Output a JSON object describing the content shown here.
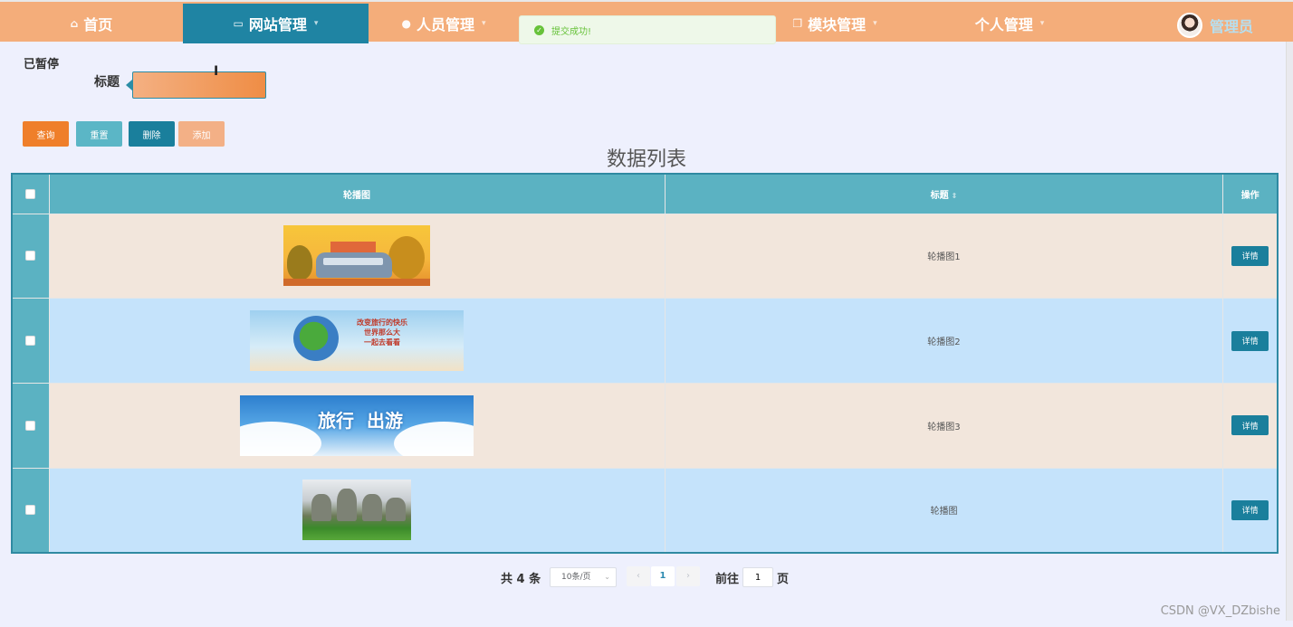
{
  "nav": {
    "items": [
      {
        "label": "首页",
        "icon": "home-icon",
        "active": false,
        "dropdown": false
      },
      {
        "label": "网站管理",
        "icon": "monitor-icon",
        "active": true,
        "dropdown": true
      },
      {
        "label": "人员管理",
        "icon": "user-icon",
        "active": false,
        "dropdown": true
      },
      {
        "label": "模块管理",
        "icon": "module-icon",
        "active": false,
        "dropdown": true
      },
      {
        "label": "个人管理",
        "icon": "",
        "active": false,
        "dropdown": true
      }
    ],
    "admin_label": "管理员"
  },
  "toast": {
    "message": "提交成功!",
    "type": "success"
  },
  "status_text": "已暂停",
  "search": {
    "label": "标题",
    "value": ""
  },
  "buttons": {
    "query": "查询",
    "reset": "重置",
    "delete": "删除",
    "add": "添加"
  },
  "list_title": "数据列表",
  "table": {
    "headers": {
      "image": "轮播图",
      "title": "标题",
      "actions": "操作"
    },
    "rows": [
      {
        "title": "轮播图1",
        "action": "详情",
        "image": "autumn-bus-illustration"
      },
      {
        "title": "轮播图2",
        "action": "详情",
        "image": "travel-globe-banner",
        "image_text": [
          "改变旅行的快乐",
          "世界那么大",
          "一起去看看"
        ]
      },
      {
        "title": "轮播图3",
        "action": "详情",
        "image": "travel-clouds-banner",
        "image_text": [
          "旅行",
          "出游"
        ]
      },
      {
        "title": "轮播图",
        "action": "详情",
        "image": "stone-forest-landscape"
      }
    ]
  },
  "pagination": {
    "total_text": "共 4 条",
    "page_size": "10条/页",
    "current_page": "1",
    "goto_label": "前往",
    "goto_value": "1",
    "page_suffix": "页"
  },
  "watermark": "CSDN @VX_DZbishe",
  "colors": {
    "topbar": "#f4ad7a",
    "active_nav": "#1f84a3",
    "table_header": "#5bb2c2",
    "row_odd": "#f2e6dc",
    "row_even": "#c5e3fb",
    "detail_button": "#1a7f9c"
  }
}
